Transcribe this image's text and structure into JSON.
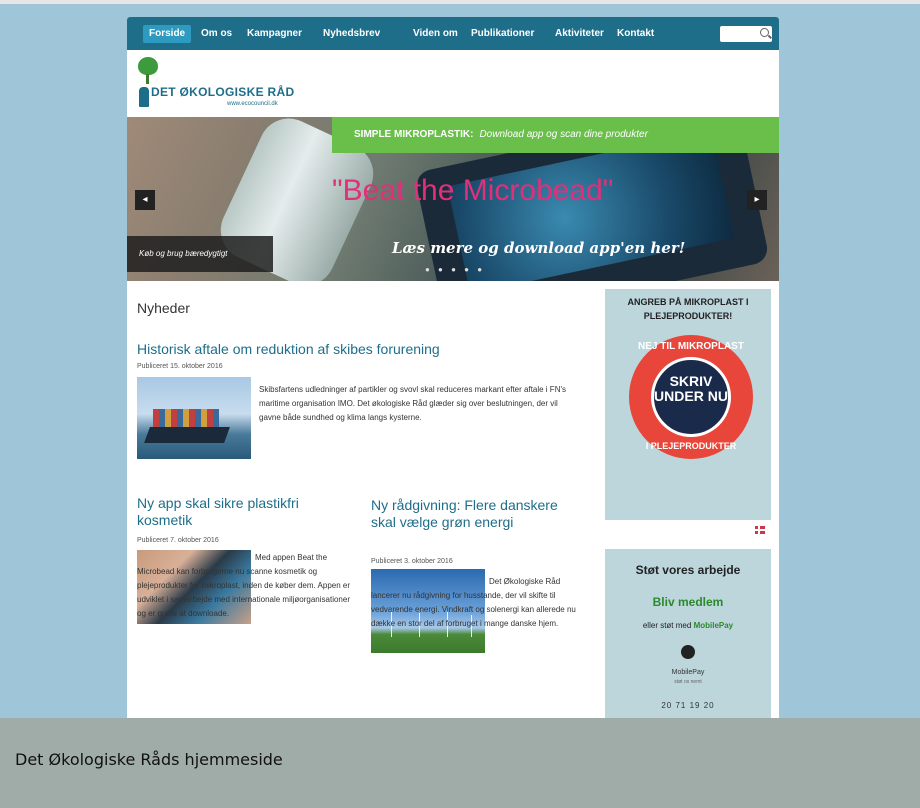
{
  "nav": {
    "items": [
      "Forside",
      "Om os",
      "Kampagner",
      "Nyhedsbrev",
      "Viden om",
      "Publikationer",
      "Aktiviteter",
      "Kontakt"
    ]
  },
  "logo": {
    "name": "DET ØKOLOGISKE RÅD",
    "tagline": "www.ecocouncil.dk"
  },
  "hero": {
    "banner_strong": "SIMPLE MIKROPLASTIK:",
    "banner_text": "Download app og scan dine produkter",
    "title": "\"Beat the Microbead\"",
    "subtitle": "Læs mere og download app'en her!",
    "caption": "Køb og brug bæredygtigt",
    "prev_arrow": "◂",
    "next_arrow": "▸",
    "dots": "● ● ● ● ●"
  },
  "main": {
    "section_title": "Nyheder",
    "articles": [
      {
        "title": "Historisk aftale om reduktion af skibes forurening",
        "date": "Publiceret 15. oktober 2016",
        "body": "Skibsfartens udledninger af partikler og svovl skal reduceres markant efter aftale i FN's maritime organisation IMO. Det økologiske Råd glæder sig over beslutningen, der vil gavne både sundhed og klima langs kysterne."
      },
      {
        "title": "Ny app skal sikre plastikfri kosmetik",
        "date": "Publiceret 7. oktober 2016",
        "body": "Med appen Beat the Microbead kan forbrugerne nu scanne kosmetik og plejeprodukter for mikroplast, inden de køber dem. Appen er udviklet i samarbejde med internationale miljøorganisationer og er gratis at downloade."
      },
      {
        "title": "Ny rådgivning: Flere danskere skal vælge grøn energi",
        "date": "Publiceret 3. oktober 2016",
        "body": "Det Økologiske Råd lancerer nu rådgivning for husstande, der vil skifte til vedvarende energi. Vindkraft og solenergi kan allerede nu dække en stor del af forbruget i mange danske hjem."
      }
    ]
  },
  "sidebar": {
    "campaign_heading": "ANGREB PÅ MIKROPLAST I PLEJEPRODUKTER!",
    "stamp_ring_top": "NEJ TIL MIKROPLAST",
    "stamp_center": "SKRIV UNDER NU",
    "stamp_ring_bottom": "I PLEJEPRODUKTER",
    "support_title": "Støt vores arbejde",
    "support_link": "Bliv medlem",
    "support_sub_prefix": "eller støt med",
    "support_sub_link": "MobilePay",
    "support_logo_text": "MobilePay",
    "support_logo_sub": "støt os nemt",
    "support_number": "20 71 19 20"
  },
  "caption": {
    "text": "Det Økologiske Råds hjemmeside"
  }
}
